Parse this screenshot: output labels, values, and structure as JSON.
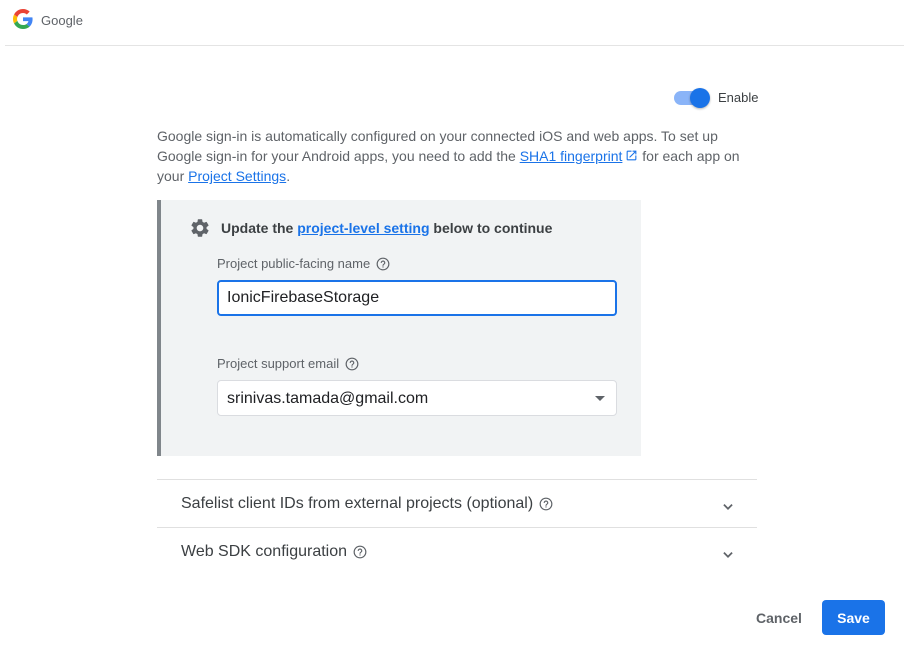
{
  "header": {
    "provider_name": "Google",
    "logo_icon": "google-g-icon"
  },
  "toggle": {
    "label": "Enable",
    "state": "on",
    "color": "#1a73e8"
  },
  "description": {
    "part1": "Google sign-in is automatically configured on your connected iOS and web apps. To set up Google sign-in for your Android apps, you need to add the ",
    "link1": "SHA1 fingerprint",
    "part2": " for each app on your ",
    "link2": "Project Settings",
    "part3": "."
  },
  "panel": {
    "title_prefix": "Update the ",
    "title_link": "project-level setting",
    "title_suffix": " below to continue",
    "name_label": "Project public-facing name",
    "name_value": "IonicFirebaseStorage",
    "email_label": "Project support email",
    "email_value": "srinivas.tamada@gmail.com"
  },
  "expanders": [
    {
      "label": "Safelist client IDs from external projects (optional)"
    },
    {
      "label": "Web SDK configuration"
    }
  ],
  "actions": {
    "cancel": "Cancel",
    "save": "Save"
  }
}
